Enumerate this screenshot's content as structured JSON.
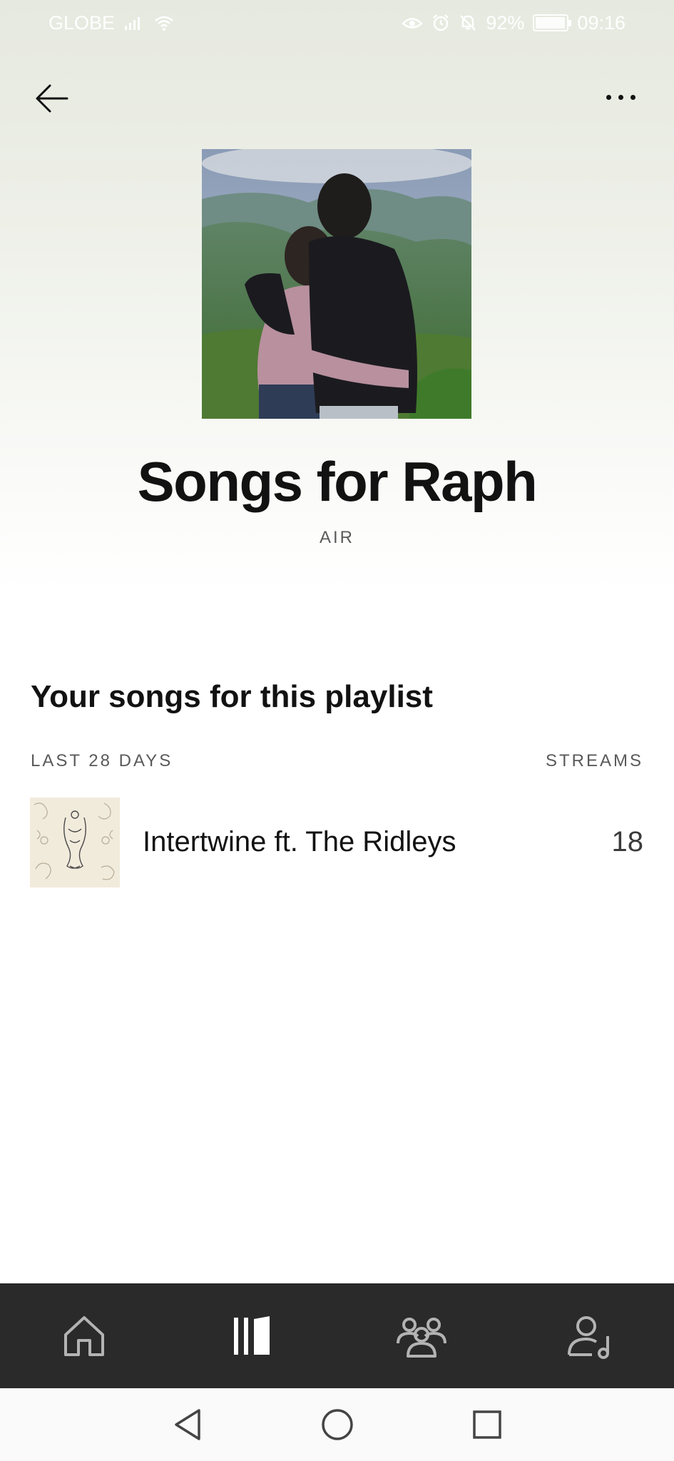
{
  "status_bar": {
    "carrier": "GLOBE",
    "battery_percent": "92%",
    "time": "09:16"
  },
  "header": {
    "back_icon": "arrow-left-icon",
    "more_icon": "more-horizontal-icon"
  },
  "playlist": {
    "title": "Songs for Raph",
    "owner": "AIR"
  },
  "songs_section": {
    "heading": "Your songs for this playlist",
    "period_label": "LAST 28 DAYS",
    "streams_label": "STREAMS",
    "songs": [
      {
        "title": "Intertwine ft. The Ridleys",
        "streams": "18"
      }
    ]
  },
  "bottom_nav": {
    "items": [
      {
        "icon": "home-icon"
      },
      {
        "icon": "library-icon"
      },
      {
        "icon": "audience-icon"
      },
      {
        "icon": "artist-profile-icon"
      }
    ]
  },
  "system_nav": {
    "items": [
      "back-triangle-icon",
      "home-circle-icon",
      "recents-square-icon"
    ]
  },
  "colors": {
    "background_top": "#e6e9df",
    "text_primary": "#121212",
    "text_secondary": "#5a5a5a",
    "nav_background": "#2a2a2a"
  }
}
